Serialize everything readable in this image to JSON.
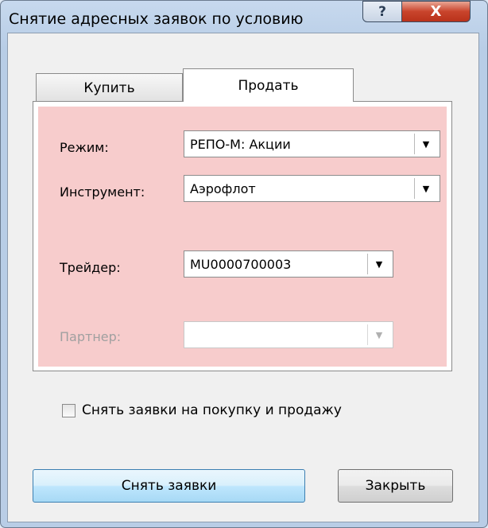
{
  "window": {
    "title": "Снятие адресных заявок по условию",
    "help_label": "?",
    "close_label": "X"
  },
  "tabs": [
    {
      "label": "Купить",
      "active": false
    },
    {
      "label": "Продать",
      "active": true
    }
  ],
  "form": {
    "mode": {
      "label": "Режим:",
      "value": "РЕПО-М: Акции"
    },
    "instrument": {
      "label": "Инструмент:",
      "value": "Аэрофлот"
    },
    "trader": {
      "label": "Трейдер:",
      "value": "MU0000700003"
    },
    "partner": {
      "label": "Партнер:",
      "value": "",
      "disabled": true
    }
  },
  "checkbox": {
    "label": "Снять заявки на покупку и продажу",
    "checked": false
  },
  "buttons": {
    "primary": "Снять заявки",
    "close": "Закрыть"
  },
  "colors": {
    "panel_background": "#f7cccc",
    "window_frame": "#b9cde6",
    "close_button": "#c9442c"
  }
}
